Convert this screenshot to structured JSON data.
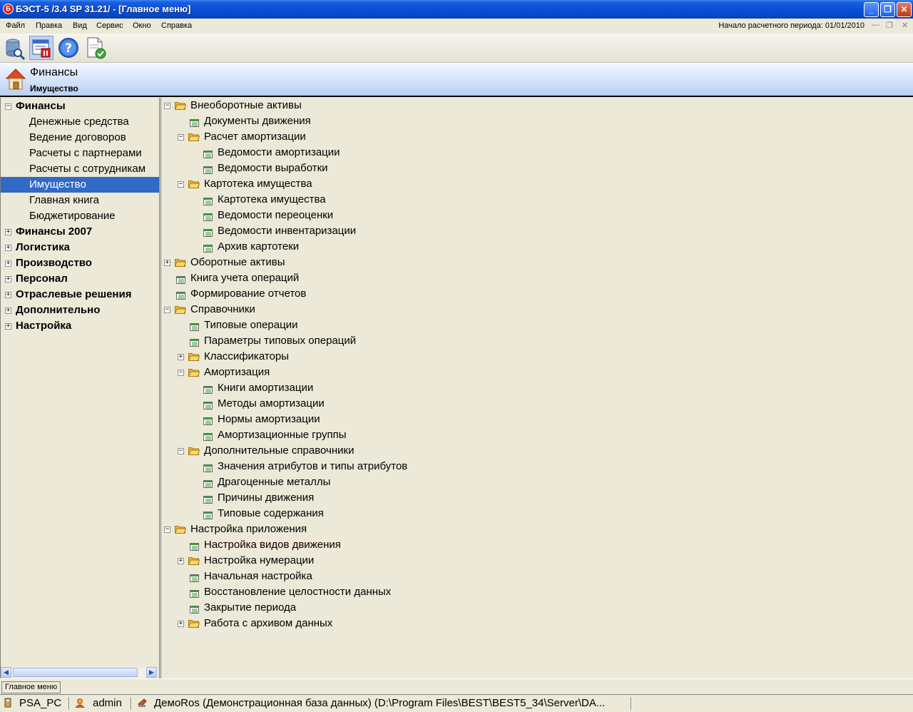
{
  "window": {
    "icon_letter": "Б",
    "title": "БЭСТ-5 /3.4 SP 31.21/ - [Главное меню]",
    "minimize": "_",
    "maximize": "❐",
    "close": "✕"
  },
  "menu": {
    "items": [
      "Файл",
      "Правка",
      "Вид",
      "Сервис",
      "Окно",
      "Справка"
    ],
    "period_label": "Начало расчетного периода: 01/01/2010",
    "mdi_min": "—",
    "mdi_restore": "❐",
    "mdi_close": "✕"
  },
  "toolbar": {
    "buttons": [
      "database-search-icon",
      "main-menu-icon",
      "help-icon",
      "document-check-icon"
    ],
    "help_glyph": "?"
  },
  "header": {
    "title": "Финансы",
    "subtitle": "Имущество"
  },
  "left_tree": [
    {
      "label": "Финансы",
      "level": 0,
      "expander": "−"
    },
    {
      "label": "Денежные средства",
      "level": 1
    },
    {
      "label": "Ведение договоров",
      "level": 1
    },
    {
      "label": "Расчеты с партнерами",
      "level": 1
    },
    {
      "label": "Расчеты с сотрудникам",
      "level": 1
    },
    {
      "label": "Имущество",
      "level": 1,
      "selected": true
    },
    {
      "label": "Главная книга",
      "level": 1
    },
    {
      "label": "Бюджетирование",
      "level": 1
    },
    {
      "label": "Финансы 2007",
      "level": 0,
      "expander": "+"
    },
    {
      "label": "Логистика",
      "level": 0,
      "expander": "+"
    },
    {
      "label": "Производство",
      "level": 0,
      "expander": "+"
    },
    {
      "label": "Персонал",
      "level": 0,
      "expander": "+"
    },
    {
      "label": "Отраслевые решения",
      "level": 0,
      "expander": "+"
    },
    {
      "label": "Дополнительно",
      "level": 0,
      "expander": "+"
    },
    {
      "label": "Настройка",
      "level": 0,
      "expander": "+"
    }
  ],
  "left_scroll": {
    "left": "◀",
    "right": "▶"
  },
  "right_tree": [
    {
      "label": "Внеоборотные активы",
      "level": 0,
      "type": "folder",
      "expander": "−"
    },
    {
      "label": "Документы движения",
      "level": 1,
      "type": "doc"
    },
    {
      "label": "Расчет амортизации",
      "level": 1,
      "type": "folder",
      "expander": "−"
    },
    {
      "label": "Ведомости амортизации",
      "level": 2,
      "type": "doc"
    },
    {
      "label": "Ведомости выработки",
      "level": 2,
      "type": "doc"
    },
    {
      "label": "Картотека имущества",
      "level": 1,
      "type": "folder",
      "expander": "−"
    },
    {
      "label": "Картотека имущества",
      "level": 2,
      "type": "doc"
    },
    {
      "label": "Ведомости переоценки",
      "level": 2,
      "type": "doc"
    },
    {
      "label": "Ведомости инвентаризации",
      "level": 2,
      "type": "doc"
    },
    {
      "label": "Архив картотеки",
      "level": 2,
      "type": "doc"
    },
    {
      "label": "Оборотные активы",
      "level": 0,
      "type": "folder",
      "expander": "+"
    },
    {
      "label": "Книга учета операций",
      "level": 0,
      "type": "doc"
    },
    {
      "label": "Формирование отчетов",
      "level": 0,
      "type": "doc"
    },
    {
      "label": "Справочники",
      "level": 0,
      "type": "folder",
      "expander": "−"
    },
    {
      "label": "Типовые операции",
      "level": 1,
      "type": "doc"
    },
    {
      "label": "Параметры  типовых операций",
      "level": 1,
      "type": "doc"
    },
    {
      "label": "Классификаторы",
      "level": 1,
      "type": "folder",
      "expander": "+"
    },
    {
      "label": "Амортизация",
      "level": 1,
      "type": "folder",
      "expander": "−"
    },
    {
      "label": "Книги амортизации",
      "level": 2,
      "type": "doc"
    },
    {
      "label": "Методы амортизации",
      "level": 2,
      "type": "doc"
    },
    {
      "label": "Нормы амортизации",
      "level": 2,
      "type": "doc"
    },
    {
      "label": "Амортизационные группы",
      "level": 2,
      "type": "doc"
    },
    {
      "label": "Дополнительные справочники",
      "level": 1,
      "type": "folder",
      "expander": "−"
    },
    {
      "label": "Значения атрибутов и типы атрибутов",
      "level": 2,
      "type": "doc"
    },
    {
      "label": "Драгоценные металлы",
      "level": 2,
      "type": "doc"
    },
    {
      "label": "Причины движения",
      "level": 2,
      "type": "doc"
    },
    {
      "label": "Типовые содержания",
      "level": 2,
      "type": "doc"
    },
    {
      "label": "Настройка приложения",
      "level": 0,
      "type": "folder",
      "expander": "−"
    },
    {
      "label": "Настройка видов движения",
      "level": 1,
      "type": "doc",
      "highlight": true
    },
    {
      "label": "Настройка нумерации",
      "level": 1,
      "type": "folder",
      "expander": "+"
    },
    {
      "label": "Начальная настройка",
      "level": 1,
      "type": "doc"
    },
    {
      "label": "Восстановление целостности данных",
      "level": 1,
      "type": "doc"
    },
    {
      "label": "Закрытие периода",
      "level": 1,
      "type": "doc"
    },
    {
      "label": "Работа с архивом данных",
      "level": 1,
      "type": "folder",
      "expander": "+"
    }
  ],
  "status1": {
    "text": "Главное меню"
  },
  "status2": {
    "computer": "PSA_PC",
    "user": "admin",
    "database": "ДемоRos (Демонстрационная база данных) (D:\\Program Files\\BEST\\BEST5_34\\Server\\DA..."
  },
  "colors": {
    "titlebar": "#0a4fd6",
    "selection": "#316ac5",
    "header_band": "#b9cff3",
    "folder": "#f5c542",
    "doc_green": "#3c9a3c"
  }
}
